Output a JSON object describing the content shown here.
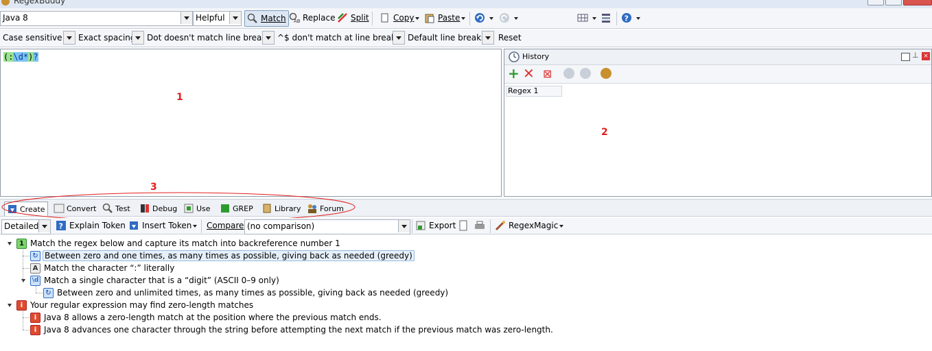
{
  "window": {
    "title": "RegexBuddy"
  },
  "toolbar1": {
    "flavor": "Java 8",
    "help_mode": "Helpful",
    "match": "Match",
    "replace": "Replace",
    "split": "Split",
    "copy": "Copy",
    "paste": "Paste"
  },
  "options": {
    "case": "Case sensitive",
    "spacing": "Exact spacing",
    "dot": "Dot doesn't match line breaks",
    "anchors": "^$ don't match at line breaks",
    "linebreaks": "Default line breaks",
    "reset": "Reset"
  },
  "regex": {
    "part1": "(",
    "part2": ":",
    "part3": "\\d*",
    "part4": ")",
    "part5": "?"
  },
  "annotations": {
    "m1": "1",
    "m2": "2",
    "m3": "3"
  },
  "history": {
    "title": "History",
    "item": "Regex 1"
  },
  "tabs": [
    "Create",
    "Convert",
    "Test",
    "Debug",
    "Use",
    "GREP",
    "Library",
    "Forum"
  ],
  "create_toolbar": {
    "mode": "Detailed",
    "explain": "Explain Token",
    "insert": "Insert Token",
    "compare_label": "Compare",
    "compare_value": "(no comparison)",
    "export": "Export",
    "regexmagic": "RegexMagic"
  },
  "tree": [
    {
      "text": "Match the regex below and capture its match into backreference number 1",
      "badge": "1"
    },
    {
      "text": "Between zero and one times, as many times as possible, giving back as needed (greedy)",
      "badge": "↻"
    },
    {
      "text": "Match the character “:” literally",
      "badge": "A"
    },
    {
      "text": "Match a single character that is a “digit” (ASCII 0–9 only)",
      "badge": "\\d"
    },
    {
      "text": "Between zero and unlimited times, as many times as possible, giving back as needed (greedy)",
      "badge": "↻"
    },
    {
      "text": "Your regular expression may find zero-length matches",
      "badge": "i"
    },
    {
      "text": "Java 8 allows a zero-length match at the position where the previous match ends.",
      "badge": "i"
    },
    {
      "text": "Java 8 advances one character through the string before attempting the next match if the previous match was zero-length.",
      "badge": "i"
    }
  ],
  "colors": {
    "annotation_red": "#e11d1d",
    "group_green": "#9ae58f",
    "token_blue": "#7cc3f5"
  }
}
